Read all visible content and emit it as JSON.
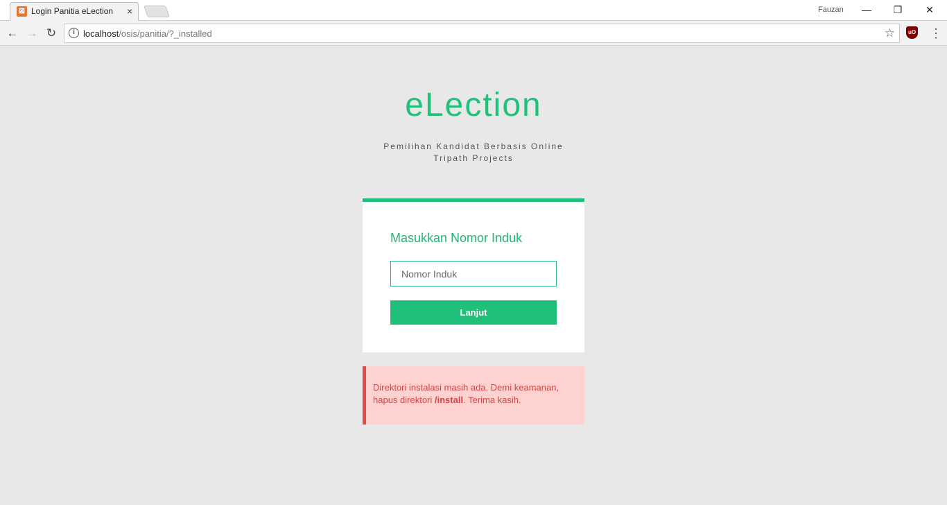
{
  "browser": {
    "tab_title": "Login Panitia eLection",
    "tab_favicon": "xampp-icon",
    "tab_close": "×",
    "profile_name": "Fauzan",
    "url_host": "localhost",
    "url_path": "/osis/panitia/?_installed",
    "window_minimize": "—",
    "window_maximize": "❐",
    "window_close": "✕",
    "back": "←",
    "forward": "→",
    "reload": "↻",
    "star": "☆",
    "info": "i",
    "extension_label": "uO",
    "menu": "⋮"
  },
  "page": {
    "brand": "eLection",
    "subtitle_line1": "Pemilihan Kandidat Berbasis Online",
    "subtitle_line2": "Tripath Projects",
    "form": {
      "title": "Masukkan Nomor Induk",
      "input_placeholder": "Nomor Induk",
      "input_value": "",
      "submit_label": "Lanjut"
    },
    "alert": {
      "text_before": "Direktori instalasi masih ada. Demi keamanan, hapus direktori ",
      "text_bold": "/install",
      "text_after": ". Terima kasih."
    }
  },
  "colors": {
    "accent": "#1fc07a",
    "background": "#e8e8e8",
    "alert_bg": "#ffd2d2",
    "alert_border": "#e44b4b",
    "alert_text": "#d64242"
  }
}
